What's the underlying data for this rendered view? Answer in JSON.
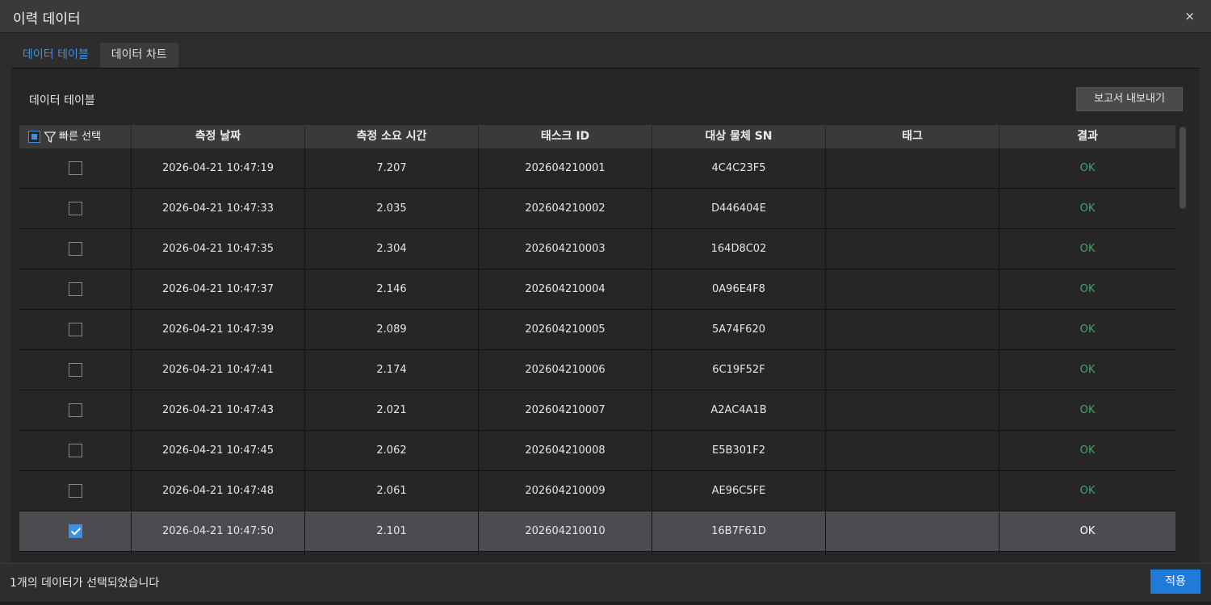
{
  "window": {
    "title": "이력 데이터",
    "close_glyph": "×"
  },
  "tabs": [
    {
      "label": "데이터 테이블",
      "active": true
    },
    {
      "label": "데이터 차트",
      "active": false
    }
  ],
  "panel": {
    "title": "데이터 테이블",
    "export_label": "보고서 내보내기"
  },
  "table": {
    "quick_select_label": "빠른 선택",
    "columns": [
      "측정 날짜",
      "측정 소요 시간",
      "태스크 ID",
      "대상 물체 SN",
      "태그",
      "결과"
    ],
    "rows": [
      {
        "date": "2026-04-21 10:47:19",
        "duration": "7.207",
        "task_id": "202604210001",
        "sn": "4C4C23F5",
        "tag": "",
        "result": "OK",
        "checked": false
      },
      {
        "date": "2026-04-21 10:47:33",
        "duration": "2.035",
        "task_id": "202604210002",
        "sn": "D446404E",
        "tag": "",
        "result": "OK",
        "checked": false
      },
      {
        "date": "2026-04-21 10:47:35",
        "duration": "2.304",
        "task_id": "202604210003",
        "sn": "164D8C02",
        "tag": "",
        "result": "OK",
        "checked": false
      },
      {
        "date": "2026-04-21 10:47:37",
        "duration": "2.146",
        "task_id": "202604210004",
        "sn": "0A96E4F8",
        "tag": "",
        "result": "OK",
        "checked": false
      },
      {
        "date": "2026-04-21 10:47:39",
        "duration": "2.089",
        "task_id": "202604210005",
        "sn": "5A74F620",
        "tag": "",
        "result": "OK",
        "checked": false
      },
      {
        "date": "2026-04-21 10:47:41",
        "duration": "2.174",
        "task_id": "202604210006",
        "sn": "6C19F52F",
        "tag": "",
        "result": "OK",
        "checked": false
      },
      {
        "date": "2026-04-21 10:47:43",
        "duration": "2.021",
        "task_id": "202604210007",
        "sn": "A2AC4A1B",
        "tag": "",
        "result": "OK",
        "checked": false
      },
      {
        "date": "2026-04-21 10:47:45",
        "duration": "2.062",
        "task_id": "202604210008",
        "sn": "E5B301F2",
        "tag": "",
        "result": "OK",
        "checked": false
      },
      {
        "date": "2026-04-21 10:47:48",
        "duration": "2.061",
        "task_id": "202604210009",
        "sn": "AE96C5FE",
        "tag": "",
        "result": "OK",
        "checked": false
      },
      {
        "date": "2026-04-21 10:47:50",
        "duration": "2.101",
        "task_id": "202604210010",
        "sn": "16B7F61D",
        "tag": "",
        "result": "OK",
        "checked": true
      }
    ]
  },
  "footer": {
    "status": "1개의 데이터가 선택되었습니다",
    "apply_label": "적용"
  },
  "colors": {
    "accent": "#3d8fe6",
    "ok": "#3ea86b",
    "apply": "#1f7ad8"
  }
}
